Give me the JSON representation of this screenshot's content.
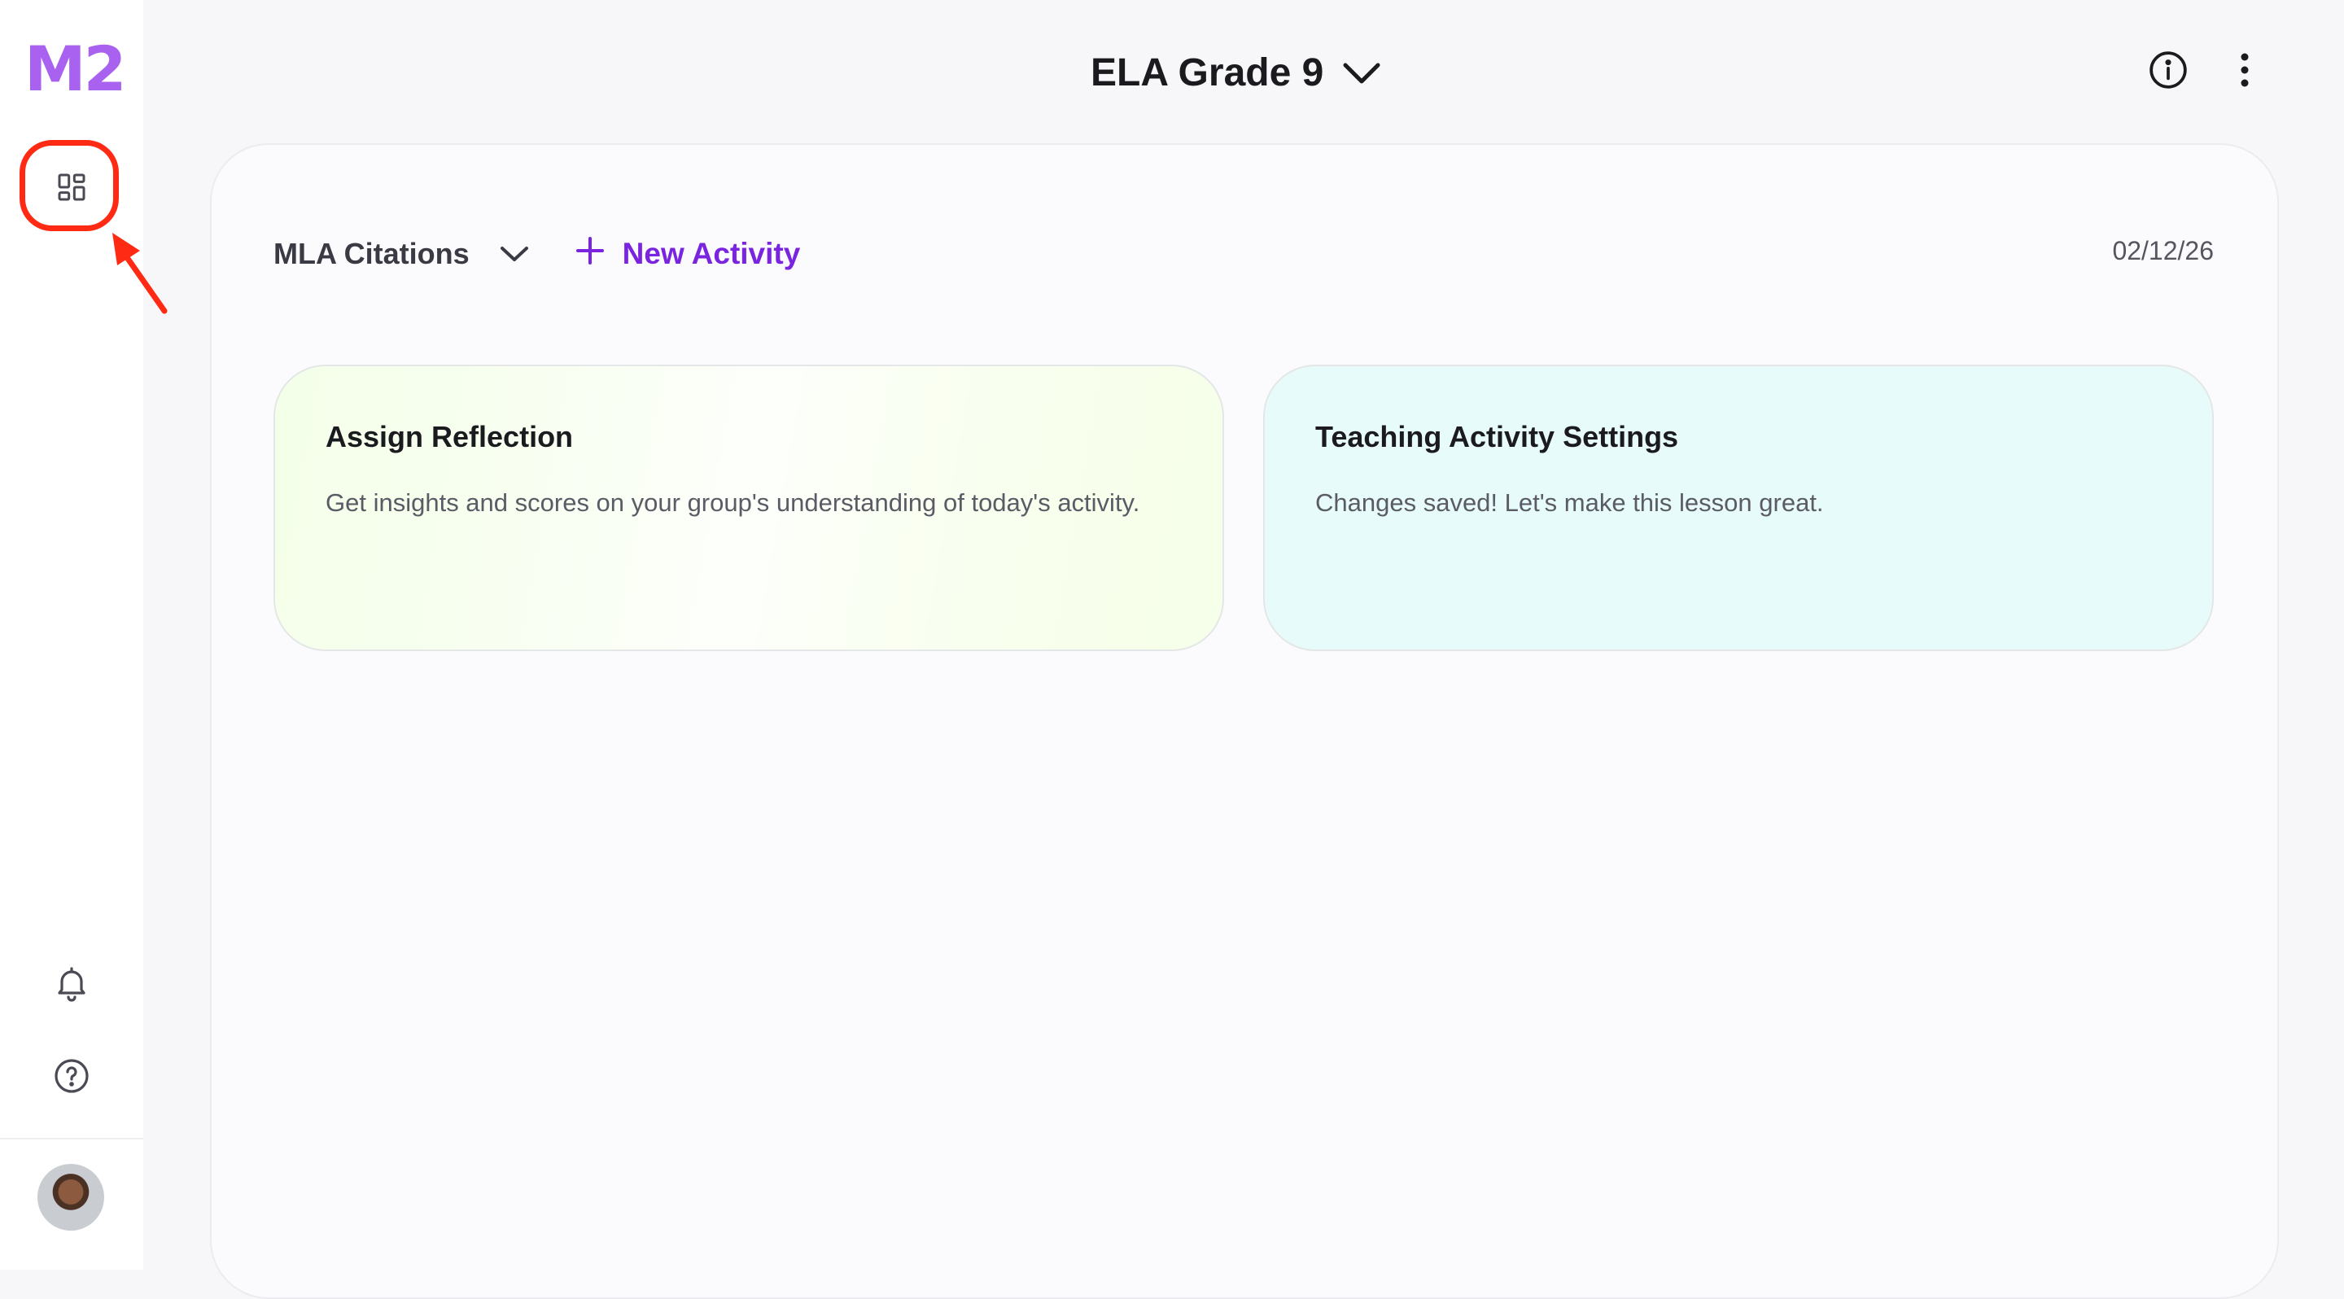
{
  "app": {
    "logo_text": "M2"
  },
  "header": {
    "course_title": "ELA Grade 9",
    "icons": [
      "chevron-down-icon",
      "info-icon",
      "more-vertical-icon"
    ]
  },
  "sidebar": {
    "items": [
      {
        "icon": "dashboard-icon",
        "highlighted": true
      },
      {
        "icon": "bell-icon"
      },
      {
        "icon": "help-icon"
      },
      {
        "icon": "avatar"
      }
    ]
  },
  "toolbar": {
    "lesson_name": "MLA Citations",
    "new_activity_label": "New Activity",
    "date": "02/12/26"
  },
  "cards": [
    {
      "title": "Assign Reflection",
      "description": "Get insights and scores on your group's understanding of today's activity."
    },
    {
      "title": "Teaching Activity Settings",
      "description": "Changes saved! Let's make this lesson great."
    }
  ],
  "colors": {
    "brand": "#a862ef",
    "accent": "#7a24e0",
    "annotation": "#ff2a14",
    "card_reflection_bg": "#f6ffe9",
    "card_settings_bg": "#e7fcfa"
  }
}
